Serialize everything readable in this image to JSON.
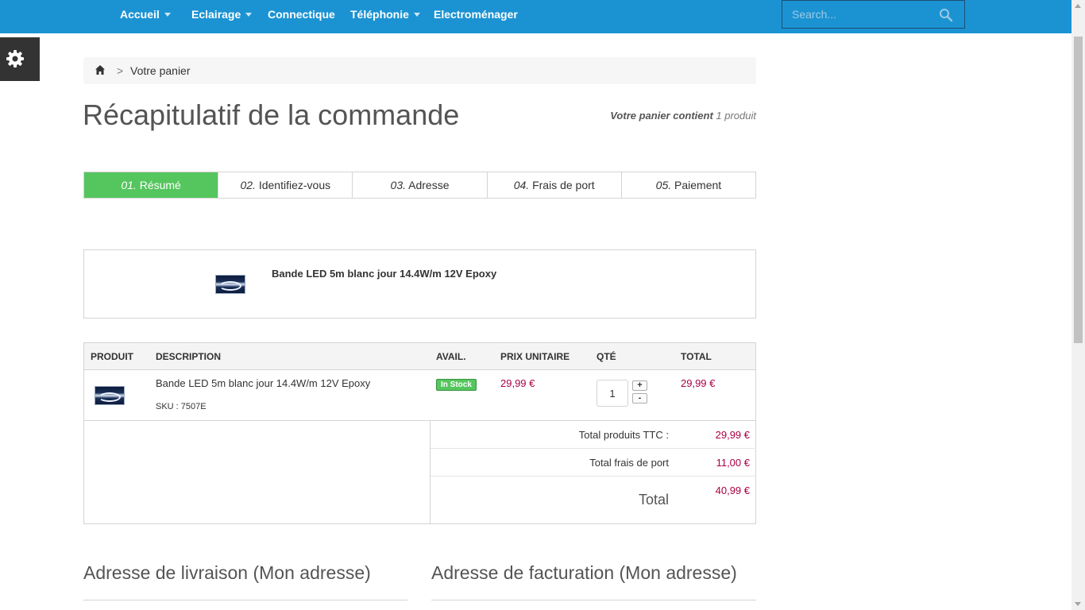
{
  "nav": {
    "items": [
      {
        "label": "Accueil",
        "has_dropdown": true
      },
      {
        "label": "Eclairage",
        "has_dropdown": true
      },
      {
        "label": "Connectique",
        "has_dropdown": false
      },
      {
        "label": "Téléphonie",
        "has_dropdown": true
      },
      {
        "label": "Electroménager",
        "has_dropdown": false
      }
    ],
    "search_placeholder": "Search...",
    "search_icon": "magnifier-icon",
    "bar_color": "#1b93d3"
  },
  "settings": {
    "icon": "gear-icon"
  },
  "breadcrumb": {
    "home_icon": "home-icon",
    "separator": ">",
    "current": "Votre panier"
  },
  "page": {
    "title": "Récapitulatif de la commande",
    "cart_count_label": "Votre panier contient",
    "cart_count_value": "1 produit"
  },
  "steps": [
    {
      "num": "01.",
      "label": "Résumé",
      "active": true
    },
    {
      "num": "02.",
      "label": "Identifiez-vous",
      "active": false
    },
    {
      "num": "03.",
      "label": "Adresse",
      "active": false
    },
    {
      "num": "04.",
      "label": "Frais de port",
      "active": false
    },
    {
      "num": "05.",
      "label": "Paiement",
      "active": false
    }
  ],
  "product_box": {
    "name": "Bande LED 5m blanc jour 14.4W/m 12V Epoxy"
  },
  "cart": {
    "headers": {
      "product": "Produit",
      "description": "Description",
      "avail": "Avail.",
      "unit_price": "Prix unitaire",
      "qty": "Qté",
      "total": "Total"
    },
    "rows": [
      {
        "name": "Bande LED 5m blanc jour 14.4W/m 12V Epoxy",
        "sku": "SKU : 7507E",
        "availability": "In Stock",
        "unit_price": "29,99 €",
        "qty": "1",
        "plus": "+",
        "minus": "-",
        "total": "29,99 €"
      }
    ],
    "totals": {
      "products_label": "Total produits TTC :",
      "products_value": "29,99 €",
      "shipping_label": "Total frais de port",
      "shipping_value": "11,00 €",
      "grand_label": "Total",
      "grand_value": "40,99 €"
    }
  },
  "addresses": {
    "delivery_title": "Adresse de livraison (Mon adresse)",
    "billing_title": "Adresse de facturation (Mon adresse)"
  },
  "colors": {
    "accent_green": "#55c65e",
    "price": "#a90043"
  }
}
